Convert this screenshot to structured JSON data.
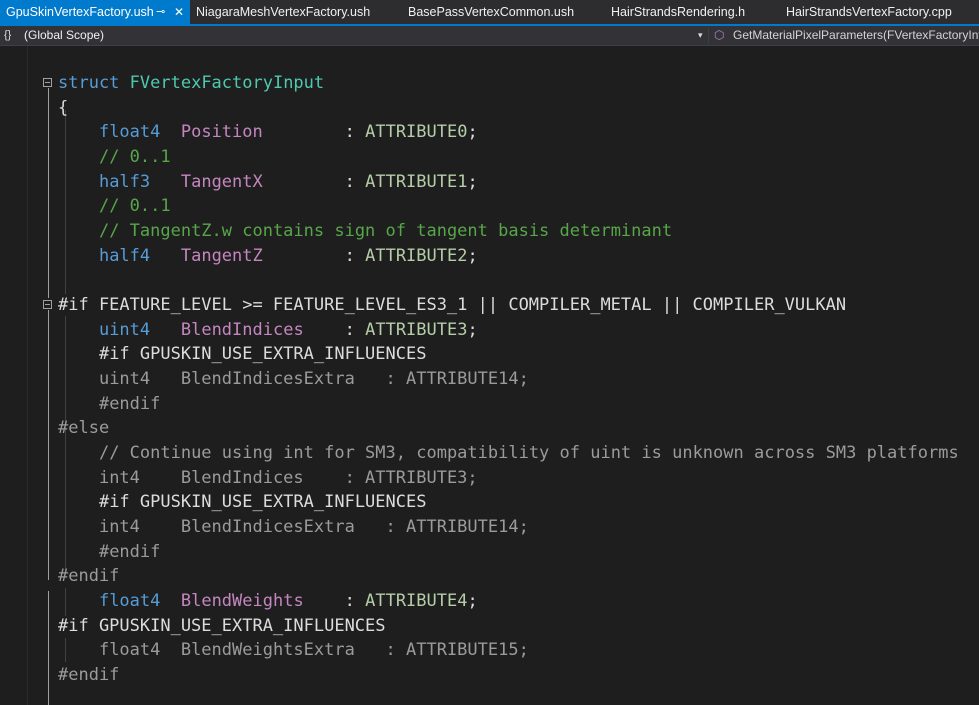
{
  "tabs": [
    {
      "label": "GpuSkinVertexFactory.ush",
      "active": true
    },
    {
      "label": "NiagaraMeshVertexFactory.ush",
      "active": false
    },
    {
      "label": "BasePassVertexCommon.ush",
      "active": false
    },
    {
      "label": "HairStrandsRendering.h",
      "active": false
    },
    {
      "label": "HairStrandsVertexFactory.cpp",
      "active": false
    }
  ],
  "icons": {
    "pin": "pin-icon",
    "close": "close-icon",
    "scope": "braces-icon",
    "member": "cube-icon"
  },
  "navbar": {
    "scope_icon": "{}",
    "scope": "(Global Scope)",
    "member": "GetMaterialPixelParameters(FVertexFactoryInte"
  },
  "colors": {
    "accent": "#007acc",
    "background": "#1e1e1e",
    "keyword": "#569cd6",
    "comment": "#57a64a",
    "member": "#c586c0",
    "attribute": "#b5cea8"
  },
  "code": {
    "l1": {
      "kw": "struct",
      "name": "FVertexFactoryInput"
    },
    "l2": {
      "text": "{"
    },
    "l3": {
      "type": "float4",
      "name": "Position",
      "sep": "        : ",
      "attr": "ATTRIBUTE0",
      "end": ";"
    },
    "l4": {
      "comment": "// 0..1"
    },
    "l5": {
      "type": "half3",
      "name": "TangentX",
      "sep": "        : ",
      "attr": "ATTRIBUTE1",
      "end": ";"
    },
    "l6": {
      "comment": "// 0..1"
    },
    "l7": {
      "comment": "// TangentZ.w contains sign of tangent basis determinant"
    },
    "l8": {
      "type": "half4",
      "name": "TangentZ",
      "sep": "        : ",
      "attr": "ATTRIBUTE2",
      "end": ";"
    },
    "l10": {
      "text": "#if FEATURE_LEVEL >= FEATURE_LEVEL_ES3_1 || COMPILER_METAL || COMPILER_VULKAN"
    },
    "l11": {
      "type": "uint4",
      "name": "BlendIndices",
      "sep": "    : ",
      "attr": "ATTRIBUTE3",
      "end": ";"
    },
    "l12": {
      "text": "#if GPUSKIN_USE_EXTRA_INFLUENCES"
    },
    "l13": {
      "text": "uint4   BlendIndicesExtra   : ATTRIBUTE14;"
    },
    "l14": {
      "text": "#endif"
    },
    "l15": {
      "text": "#else"
    },
    "l16": {
      "comment": "// Continue using int for SM3, compatibility of uint is unknown across SM3 platforms"
    },
    "l17": {
      "text": "int4    BlendIndices    : ATTRIBUTE3;"
    },
    "l18": {
      "text": "#if GPUSKIN_USE_EXTRA_INFLUENCES"
    },
    "l19": {
      "text": "int4    BlendIndicesExtra   : ATTRIBUTE14;"
    },
    "l20": {
      "text": "#endif"
    },
    "l21": {
      "text": "#endif"
    },
    "l22": {
      "type": "float4",
      "name": "BlendWeights",
      "sep": "    : ",
      "attr": "ATTRIBUTE4",
      "end": ";"
    },
    "l23": {
      "text": "#if GPUSKIN_USE_EXTRA_INFLUENCES"
    },
    "l24": {
      "text": "float4  BlendWeightsExtra   : ATTRIBUTE15;"
    },
    "l25": {
      "text": "#endif"
    }
  }
}
